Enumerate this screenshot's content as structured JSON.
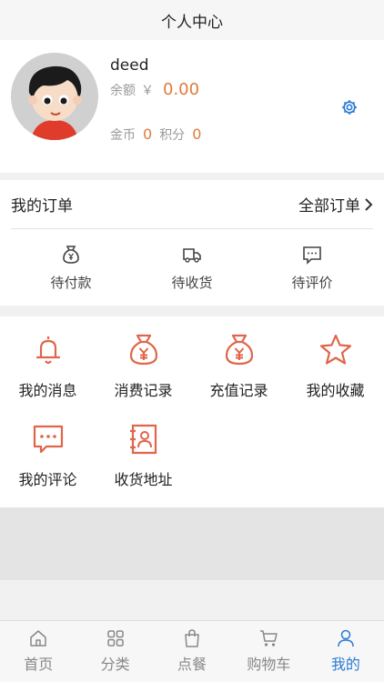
{
  "header": {
    "title": "个人中心"
  },
  "profile": {
    "username": "deed",
    "balance_label": "余额",
    "currency": "￥",
    "balance_value": "0.00",
    "coins_label": "金币",
    "coins_value": "0",
    "points_label": "积分",
    "points_value": "0"
  },
  "orders": {
    "title": "我的订单",
    "all_label": "全部订单",
    "items": [
      {
        "label": "待付款",
        "icon": "money-bag-icon"
      },
      {
        "label": "待收货",
        "icon": "delivery-truck-icon"
      },
      {
        "label": "待评价",
        "icon": "comment-icon"
      }
    ]
  },
  "features": [
    {
      "label": "我的消息",
      "icon": "bell-icon"
    },
    {
      "label": "消费记录",
      "icon": "money-bag-icon"
    },
    {
      "label": "充值记录",
      "icon": "money-bag-icon"
    },
    {
      "label": "我的收藏",
      "icon": "star-icon"
    },
    {
      "label": "我的评论",
      "icon": "comment-icon"
    },
    {
      "label": "收货地址",
      "icon": "address-book-icon"
    }
  ],
  "tabbar": {
    "items": [
      {
        "label": "首页",
        "icon": "home-icon"
      },
      {
        "label": "分类",
        "icon": "grid-icon"
      },
      {
        "label": "点餐",
        "icon": "shopping-bag-icon"
      },
      {
        "label": "购物车",
        "icon": "cart-icon"
      },
      {
        "label": "我的",
        "icon": "user-icon",
        "active": true
      }
    ]
  },
  "colors": {
    "accent": "#e07a3a",
    "icon": "#e0654a",
    "active": "#2a7ad6"
  }
}
